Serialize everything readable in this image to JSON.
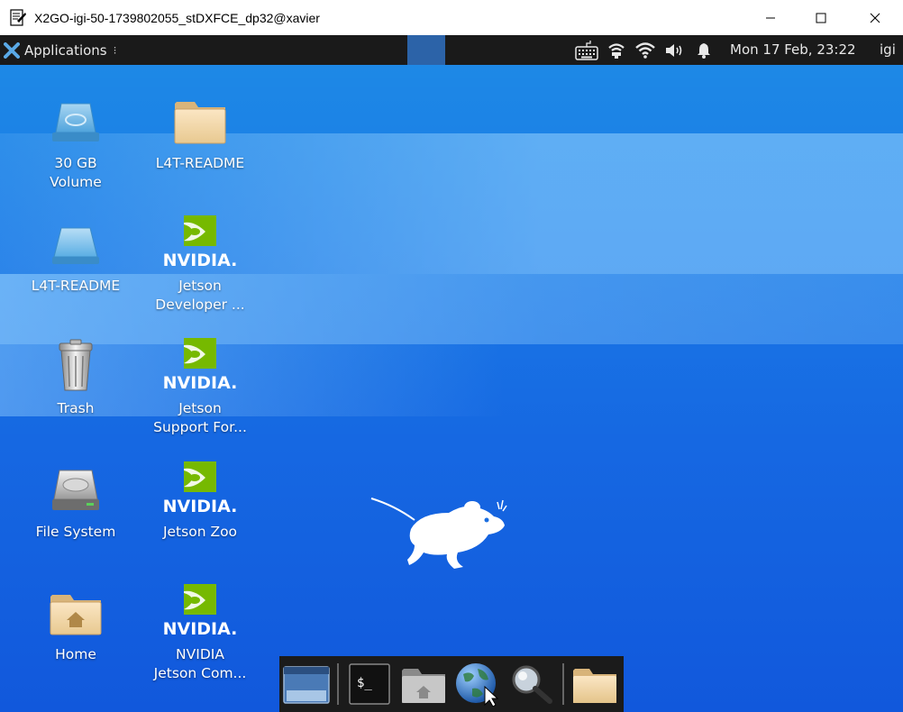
{
  "window": {
    "title": "X2GO-igi-50-1739802055_stDXFCE_dp32@xavier",
    "icon": "x2go-window-icon",
    "controls": [
      "minimize-icon",
      "maximize-icon",
      "close-icon"
    ]
  },
  "panel": {
    "applications_label": "Applications",
    "applications_sep": "⁝",
    "tray_icons": [
      "keyboard-icon",
      "network-icon",
      "wifi-icon",
      "volume-icon",
      "notification-bell-icon"
    ],
    "clock": "Mon 17 Feb, 23:22",
    "user": "igi"
  },
  "desktop_icons": [
    {
      "label": "30 GB\nVolume",
      "icon": "drive-icon"
    },
    {
      "label": "L4T-README",
      "icon": "folder-icon"
    },
    {
      "label": "L4T-README",
      "icon": "removable-drive-icon"
    },
    {
      "label": "Jetson\nDeveloper ...",
      "icon": "nvidia-icon",
      "brand": "NVIDIA."
    },
    {
      "label": "Trash",
      "icon": "trash-icon"
    },
    {
      "label": "Jetson\nSupport For...",
      "icon": "nvidia-icon",
      "brand": "NVIDIA."
    },
    {
      "label": "File System",
      "icon": "hard-disk-icon"
    },
    {
      "label": "Jetson Zoo",
      "icon": "nvidia-icon",
      "brand": "NVIDIA."
    },
    {
      "label": "Home",
      "icon": "home-folder-icon"
    },
    {
      "label": "NVIDIA\nJetson Com...",
      "icon": "nvidia-icon",
      "brand": "NVIDIA."
    }
  ],
  "dock": {
    "items": [
      "show-desktop-icon",
      "terminal-icon",
      "file-manager-icon",
      "web-browser-icon",
      "search-icon",
      "folder-icon"
    ],
    "terminal_text": "$_"
  },
  "colors": {
    "desktop_blue": "#1a7ae6",
    "panel_bg": "#1a1a1a",
    "nvidia_green": "#76b900"
  }
}
